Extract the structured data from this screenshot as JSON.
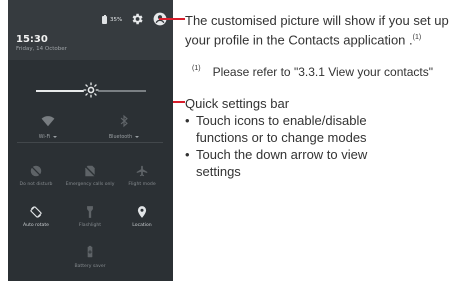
{
  "status": {
    "time": "15:30",
    "date": "Friday, 14 October",
    "battery": "35%"
  },
  "quick_settings": {
    "brightness_level": 0.5,
    "wifi_label": "Wi-Fi",
    "bluetooth_label": "Bluetooth",
    "tiles": [
      {
        "label": "Do not disturb",
        "icon": "do-not-disturb-off-icon"
      },
      {
        "label": "Emergency calls only",
        "icon": "no-sim-icon"
      },
      {
        "label": "Flight mode",
        "icon": "airplane-icon"
      },
      {
        "label": "Auto rotate",
        "icon": "auto-rotate-icon"
      },
      {
        "label": "Flashlight",
        "icon": "flashlight-icon"
      },
      {
        "label": "Location",
        "icon": "location-pin-icon"
      },
      {
        "label": "Battery saver",
        "icon": "battery-saver-icon"
      }
    ]
  },
  "annotations": {
    "profile_text": "The customised picture will show if you set up your profile in the Contacts application .",
    "profile_note_mark": "(1)",
    "footnote_mark": "(1)",
    "footnote_text": "Please refer to \"3.3.1 View your contacts\"",
    "quick_settings_title": "Quick settings bar",
    "bullet_1": "Touch icons to enable/disable functions or to change modes",
    "bullet_2": "Touch the down arrow to view settings"
  },
  "colors": {
    "callout_line": "#d81e2c",
    "panel_bg": "#2b3034",
    "header_bg": "#363b3f"
  }
}
